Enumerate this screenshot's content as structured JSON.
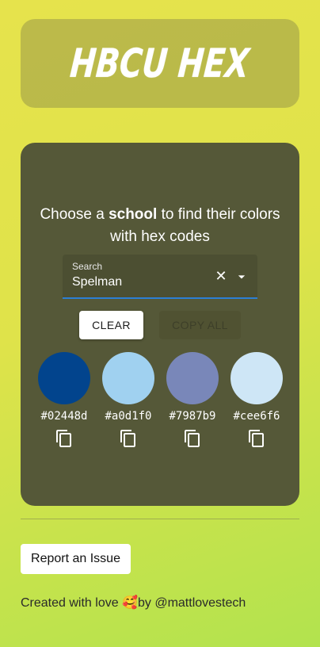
{
  "header": {
    "title": "HBCU HEX"
  },
  "card": {
    "prompt_before": "Choose a ",
    "prompt_bold": "school",
    "prompt_after": " to find their colors with hex codes",
    "search": {
      "label": "Search",
      "value": "Spelman"
    },
    "buttons": {
      "clear_label": "CLEAR",
      "copy_all_label": "COPY ALL"
    },
    "swatches": [
      {
        "hex": "#02448d",
        "color": "#02448d"
      },
      {
        "hex": "#a0d1f0",
        "color": "#a0d1f0"
      },
      {
        "hex": "#7987b9",
        "color": "#7987b9"
      },
      {
        "hex": "#cee6f6",
        "color": "#cee6f6"
      }
    ]
  },
  "footer": {
    "report_label": "Report an Issue",
    "created_text": "Created with love 🥰by @mattlovestech"
  },
  "colors": {
    "accent": "#2c7fd4",
    "card_bg": "#555838"
  }
}
